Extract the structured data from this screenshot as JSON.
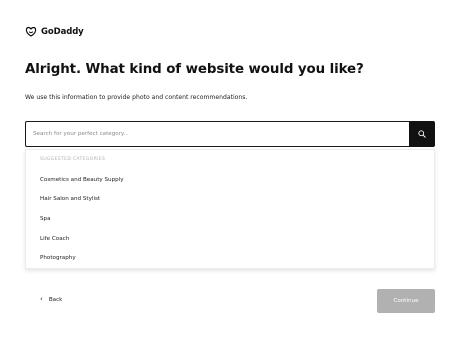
{
  "brand": {
    "name": "GoDaddy",
    "logo_icon": "godaddy-logo-icon"
  },
  "main": {
    "headline": "Alright. What kind of website would you like?",
    "subtext": "We use this information to provide photo and content recommendations."
  },
  "search": {
    "placeholder": "Search for your perfect category...",
    "value": "",
    "button_icon": "search-icon"
  },
  "suggestions": {
    "heading": "SUGGESTED CATEGORIES",
    "items": [
      "Cosmetics and Beauty Supply",
      "Hair Salon and Stylist",
      "Spa",
      "Life Coach",
      "Photography"
    ]
  },
  "footer": {
    "back_label": "Back",
    "back_icon": "chevron-left-icon",
    "continue_label": "Continue",
    "continue_disabled": true
  },
  "colors": {
    "text": "#111111",
    "search_button_bg": "#111111",
    "continue_disabled_bg": "#b1b1b1",
    "muted": "#b0b0b0"
  }
}
